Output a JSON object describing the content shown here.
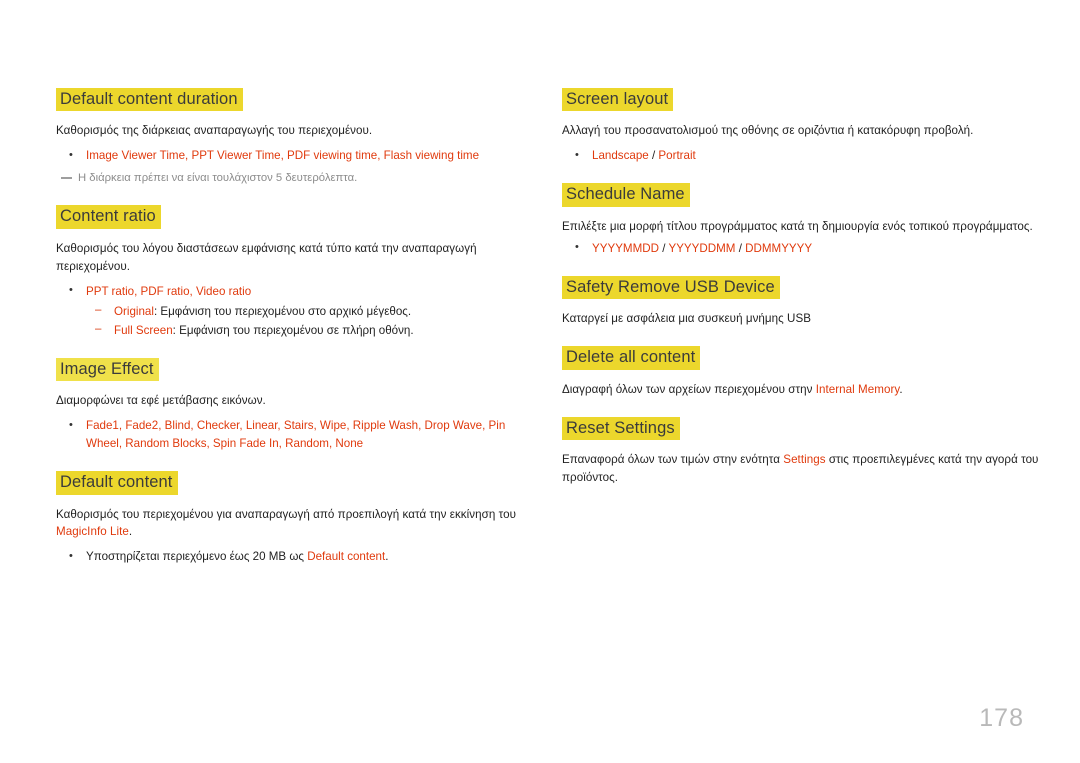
{
  "page": {
    "number": "178",
    "language": "el"
  },
  "colors": {
    "heading_highlight": "#ecd72c",
    "heading_highlight_pale": "#f0e14a",
    "heading_text": "#3b3b3b",
    "emphasis_term": "#e03a0d",
    "body_text": "#1f1f1f",
    "note_text": "#8c8c8c",
    "page_number": "#b9b9b9"
  },
  "left_column": {
    "sections": [
      {
        "heading": "Default content duration",
        "paragraph": "Καθορισμός της διάρκειας αναπαραγωγής του περιεχομένου.",
        "bullet_terms": "Image Viewer Time, PPT Viewer Time, PDF viewing time, Flash viewing time",
        "note": "Η διάρκεια πρέπει να είναι τουλάχιστον 5 δευτερόλεπτα."
      },
      {
        "heading": "Content ratio",
        "paragraph": "Καθορισμός του λόγου διαστάσεων εμφάνισης κατά τύπο κατά την αναπαραγωγή περιεχομένου.",
        "bullet_terms": "PPT ratio, PDF ratio, Video ratio",
        "subitems": [
          {
            "term": "Original",
            "text": ": Εμφάνιση του περιεχομένου στο αρχικό μέγεθος."
          },
          {
            "term": "Full Screen",
            "text": ": Εμφάνιση του περιεχομένου σε πλήρη οθόνη."
          }
        ]
      },
      {
        "heading": "Image Effect",
        "paragraph": "Διαμορφώνει τα εφέ μετάβασης εικόνων.",
        "bullet_terms": "Fade1, Fade2, Blind, Checker, Linear, Stairs, Wipe, Ripple Wash, Drop Wave, Pin Wheel, Random Blocks, Spin Fade In, Random, None"
      },
      {
        "heading": "Default content",
        "paragraph_before": "Καθορισμός του περιεχομένου για αναπαραγωγή από προεπιλογή κατά την εκκίνηση του ",
        "paragraph_term": "MagicInfo Lite",
        "paragraph_after": ".",
        "bullet_before": "Υποστηρίζεται περιεχόμενο έως 20 MB ως ",
        "bullet_term": "Default content",
        "bullet_after": "."
      }
    ]
  },
  "right_column": {
    "sections": [
      {
        "heading": "Screen layout",
        "paragraph": "Αλλαγή του προσανατολισμού της οθόνης σε οριζόντια ή κατακόρυφη προβολή.",
        "options": [
          "Landscape",
          "Portrait"
        ],
        "separator": " / "
      },
      {
        "heading": "Schedule Name",
        "paragraph": "Επιλέξτε μια μορφή τίτλου προγράμματος κατά τη δημιουργία ενός τοπικού προγράμματος.",
        "options": [
          "YYYYMMDD",
          "YYYYDDMM",
          "DDMMYYYY"
        ],
        "separator": " / "
      },
      {
        "heading": "Safety Remove USB Device",
        "paragraph": "Καταργεί με ασφάλεια μια συσκευή μνήμης USB"
      },
      {
        "heading": "Delete all content",
        "paragraph_before": "Διαγραφή όλων των αρχείων περιεχομένου στην ",
        "paragraph_term": "Internal Memory",
        "paragraph_after": "."
      },
      {
        "heading": "Reset Settings",
        "paragraph_before": "Επαναφορά όλων των τιμών στην ενότητα ",
        "paragraph_term": "Settings",
        "paragraph_after": " στις προεπιλεγμένες κατά την αγορά του προϊόντος."
      }
    ]
  }
}
